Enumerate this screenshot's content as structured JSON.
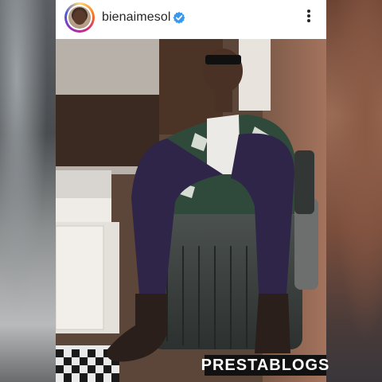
{
  "post": {
    "username": "bienaimesol",
    "verified": true
  },
  "header_icons": {
    "verified": "verified-badge-icon",
    "more": "more-options-icon"
  },
  "watermark": "PRESTABLOGS",
  "colors": {
    "verified_blue": "#3897f0",
    "text": "#262626",
    "suit": "#2e2548",
    "shirt": "#2f4a3a"
  }
}
